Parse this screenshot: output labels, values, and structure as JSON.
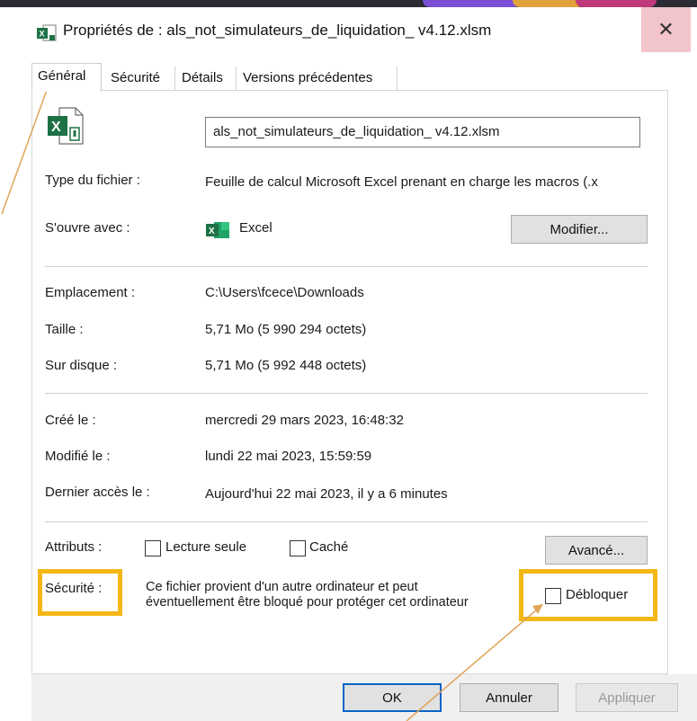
{
  "window": {
    "title": "Propriétés de : als_not_simulateurs_de_liquidation_ v4.12.xlsm",
    "close_symbol": "✕"
  },
  "tabs": [
    {
      "label": "Général",
      "active": true
    },
    {
      "label": "Sécurité",
      "active": false
    },
    {
      "label": "Détails",
      "active": false
    },
    {
      "label": "Versions précédentes",
      "active": false
    }
  ],
  "general": {
    "filename": "als_not_simulateurs_de_liquidation_ v4.12.xlsm",
    "type_label": "Type du fichier :",
    "type_value": "Feuille de calcul Microsoft Excel prenant en charge les macros (.x",
    "opens_label": "S'ouvre avec :",
    "opens_value": "Excel",
    "modify_button": "Modifier...",
    "location_label": "Emplacement :",
    "location_value": "C:\\Users\\fcece\\Downloads",
    "size_label": "Taille :",
    "size_value": "5,71 Mo (5 990 294 octets)",
    "disk_label": "Sur disque :",
    "disk_value": "5,71 Mo (5 992 448 octets)",
    "created_label": "Créé le :",
    "created_value": "mercredi 29 mars 2023, 16:48:32",
    "modified_label": "Modifié le :",
    "modified_value": "lundi 22 mai 2023, 15:59:59",
    "accessed_label": "Dernier accès le :",
    "accessed_value": "Aujourd'hui 22 mai 2023, il y a 6 minutes",
    "attributes_label": "Attributs :",
    "readonly_label": "Lecture seule",
    "readonly_checked": false,
    "hidden_label": "Caché",
    "hidden_checked": false,
    "advanced_button": "Avancé...",
    "security_label": "Sécurité :",
    "security_text_line1": "Ce fichier provient d'un autre ordinateur et peut",
    "security_text_line2": "éventuellement être bloqué pour protéger cet ordinateur",
    "unblock_label": "Débloquer",
    "unblock_checked": false
  },
  "footer": {
    "ok_button": "OK",
    "cancel_button": "Annuler",
    "apply_button": "Appliquer"
  },
  "colors": {
    "highlight": "#f3b716",
    "annotation_arrow": "#e0a458",
    "excel_green": "#1e7145",
    "close_hover": "#f2c5cb"
  },
  "icons": {
    "title_icon": "excel-file-icon",
    "file_icon": "excel-file-icon",
    "app_icon": "excel-app-icon"
  }
}
